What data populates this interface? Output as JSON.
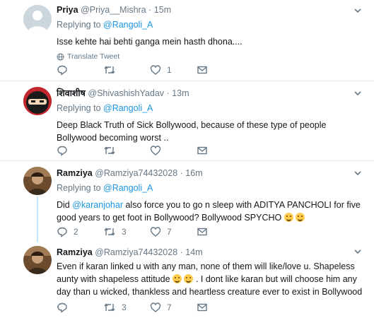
{
  "tweets": [
    {
      "name": "Priya",
      "handle": "@Priya__Mishra",
      "dot": "·",
      "time": "15m",
      "replying_prefix": "Replying to ",
      "replying_to": "@Rangoli_A",
      "text": "Isse kehte hai behti ganga mein hasth dhona....",
      "translate": "Translate Tweet",
      "reply_count": "",
      "retweet_count": "",
      "like_count": "1"
    },
    {
      "name": "शिवाशीष",
      "handle": "@ShivashishYadav",
      "dot": "·",
      "time": "13m",
      "replying_prefix": "Replying to ",
      "replying_to": "@Rangoli_A",
      "text": "Deep Black Truth of Sick Bollywood, because of these type of people Bollywood becoming worst ..",
      "reply_count": "",
      "retweet_count": "",
      "like_count": ""
    },
    {
      "name": "Ramziya",
      "handle": "@Ramziya74432028",
      "dot": "·",
      "time": "16m",
      "replying_prefix": "Replying to ",
      "replying_to": "@Rangoli_A",
      "text_before": "Did ",
      "text_mention": "@karanjohar",
      "text_after": " also force you to go n sleep with ADITYA PANCHOLI for five good years to get foot in Bollywood?  Bollywood SPYCHO ",
      "reply_count": "2",
      "retweet_count": "3",
      "like_count": "7"
    },
    {
      "name": "Ramziya",
      "handle": "@Ramziya74432028",
      "dot": "·",
      "time": "14m",
      "text_part1": "Even if karan linked u with any man, none of them will like/love u. Shapeless aunty  with shapeless attitude ",
      "text_part2": " . I dont like karan but will choose him any day than u wicked, thankless and heartless creature ever to exist in Bollywood .",
      "reply_count": "",
      "retweet_count": "3",
      "like_count": "7"
    }
  ],
  "icons": {
    "reply": "reply-icon",
    "retweet": "retweet-icon",
    "like": "heart-icon",
    "dm": "mail-icon",
    "more": "chevron-down-icon",
    "globe": "globe-icon"
  },
  "colors": {
    "link": "#1b95e0",
    "muted": "#657786",
    "thread": "#c4e6f8"
  }
}
